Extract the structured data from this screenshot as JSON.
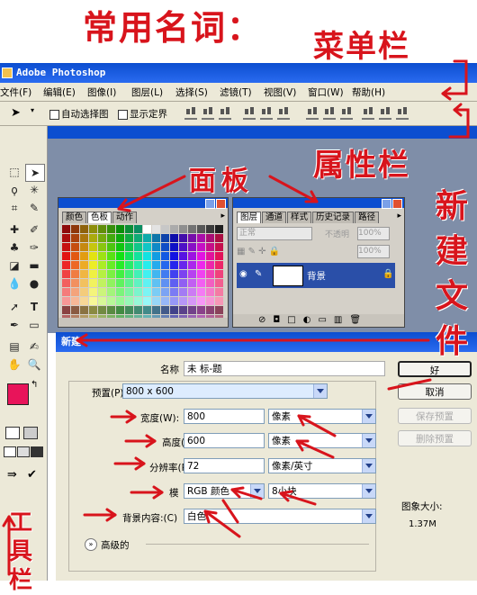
{
  "annotations": {
    "main_title": "常用名词：",
    "menu_bar": "菜单栏",
    "property_bar": "属性栏",
    "panel": "面板",
    "new_file": [
      "新",
      "建",
      "文",
      "件"
    ],
    "toolbox": [
      "工",
      "具",
      "栏"
    ]
  },
  "window": {
    "title": "Adobe Photoshop"
  },
  "menu": [
    {
      "label": "文件(F)"
    },
    {
      "label": "编辑(E)"
    },
    {
      "label": "图像(I)"
    },
    {
      "label": "图层(L)"
    },
    {
      "label": "选择(S)"
    },
    {
      "label": "滤镜(T)"
    },
    {
      "label": "视图(V)"
    },
    {
      "label": "窗口(W)"
    },
    {
      "label": "帮助(H)"
    }
  ],
  "options_bar": {
    "auto_select": "自动选择图",
    "show_bounds": "显示定界"
  },
  "color_panel": {
    "tabs": [
      "颜色",
      "色板",
      "动作"
    ],
    "active_tab": "色板"
  },
  "layers_panel": {
    "tabs": [
      "图层",
      "通道",
      "样式",
      "历史记录",
      "路径"
    ],
    "blend_mode": "正常",
    "opacity_label": "不透明",
    "opacity_value": "100%",
    "fill_value": "100%",
    "layer_name": "背景"
  },
  "dialog": {
    "title": "新建",
    "name_label": "名称",
    "name_value": "未  标-题",
    "preset_label": "预置(P):",
    "preset_value": "800 x 600",
    "width_label": "宽度(W):",
    "width_value": "800",
    "width_unit": "像素",
    "height_label": "高度(H):",
    "height_value": "600",
    "height_unit": "像素",
    "resolution_label": "分辨率(R):",
    "resolution_value": "72",
    "resolution_unit": "像素/英寸",
    "mode_label": "模",
    "mode_value": "RGB 颜色",
    "bit_depth": "8小块",
    "background_label": "背景内容:(C)",
    "background_value": "白色",
    "advanced_label": "高级的",
    "ok_label": "好",
    "cancel_label": "取消",
    "save_preset_label": "保存预置",
    "delete_preset_label": "删除预置",
    "image_size_label": "图象大小:",
    "image_size_value": "1.37M"
  },
  "colors": {
    "accent": "#0c4ed0",
    "annotation": "#d8141c",
    "fg_swatch": "#e8145a"
  }
}
